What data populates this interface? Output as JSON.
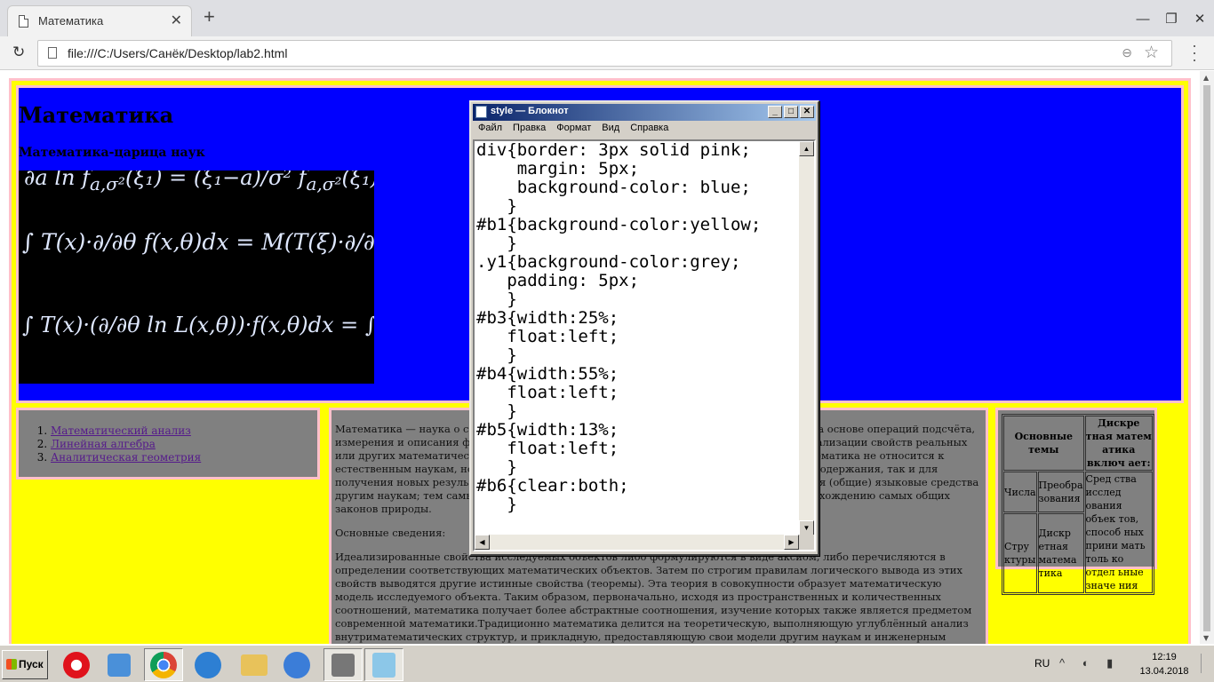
{
  "browser": {
    "tab_title": "Математика",
    "tab_close": "✕",
    "new_tab": "+",
    "window_controls": [
      "—",
      "❐",
      "✕"
    ],
    "url": "file:///C:/Users/Санёк/Desktop/lab2.html"
  },
  "page": {
    "heading": "Математика",
    "subheading": "Математика-царица наук",
    "nav_links": [
      "Математический анализ",
      "Линейная алгебра",
      "Аналитическая геометрия"
    ],
    "article_paragraphs": [
      "Математика — наука о структурах, порядке и отношениях, исторически сложившаяся на основе операций подсчёта, измерения и описания формы объектов. Математические объекты создаются путём идеализации свойств реальных или других математических объектов и записи этих свойств на формальном языке. Математика не относится к естественным наукам, но широко используется в них как для точной формулировки их содержания, так и для получения новых результатов. Математика — фундаментальная наука, предоставляющая (общие) языковые средства другим наукам; тем самым она выявляет их структурную взаимосвязь и способствует нахождению самых общих законов природы.",
      "Основные сведения:",
      "Идеализированные свойства исследуемых объектов либо формулируются в виде аксиом, либо перечисляются в определении соответствующих математических объектов. Затем по строгим правилам логического вывода из этих свойств выводятся другие истинные свойства (теоремы). Эта теория в совокупности образует математическую модель исследуемого объекта. Таким образом, первоначально, исходя из пространственных и количественных соотношений, математика получает более абстрактные соотношения, изучение которых также является предметом современной математики.Традиционно математика делится на теоретическую, выполняющую углублённый анализ внутриматематических структур, и прикладную, предоставляющую свои модели другим наукам и инженерным дисциплинам, причём некоторые из них занимают пограничное с математикой положение. В частности, формальная логика может рассматриваться и как часть философских наук, и как часть математических наук; механика — и физика, и"
    ],
    "table": {
      "headers": [
        "Основные темы",
        "Дискре тная матем атика включ ает:"
      ],
      "rows": [
        [
          "Числа",
          "Преобра зования",
          "Сред ства исслед ования объек тов, способ ных прини мать толь ко отдел ьные значе ния"
        ],
        [
          "Стру ктуры",
          "Дискр етная матема тика",
          ""
        ]
      ]
    },
    "colors": {
      "outer_bg": "#ffff00",
      "header_bg": "#0000ff",
      "block_bg": "#808080",
      "border": "#ffc0cb"
    }
  },
  "notepad": {
    "title": "style — Блокнот",
    "menu": [
      "Файл",
      "Правка",
      "Формат",
      "Вид",
      "Справка"
    ],
    "content": "div{border: 3px solid pink;\n    margin: 5px;\n    background-color: blue;\n   }\n#b1{background-color:yellow;\n   }\n.y1{background-color:grey;\n   padding: 5px;\n   }\n#b3{width:25%;\n   float:left;\n   }\n#b4{width:55%;\n   float:left;\n   }\n#b5{width:13%;\n   float:left;\n   }\n#b6{clear:both;\n   }"
  },
  "taskbar": {
    "start_label": "Пуск",
    "apps": [
      "opera-icon",
      "media-player-icon",
      "chrome-icon",
      "volume-app-icon",
      "explorer-icon",
      "mail-icon",
      "news-icon",
      "notepad-icon"
    ],
    "language": "RU",
    "time": "12:19",
    "date": "13.04.2018"
  }
}
